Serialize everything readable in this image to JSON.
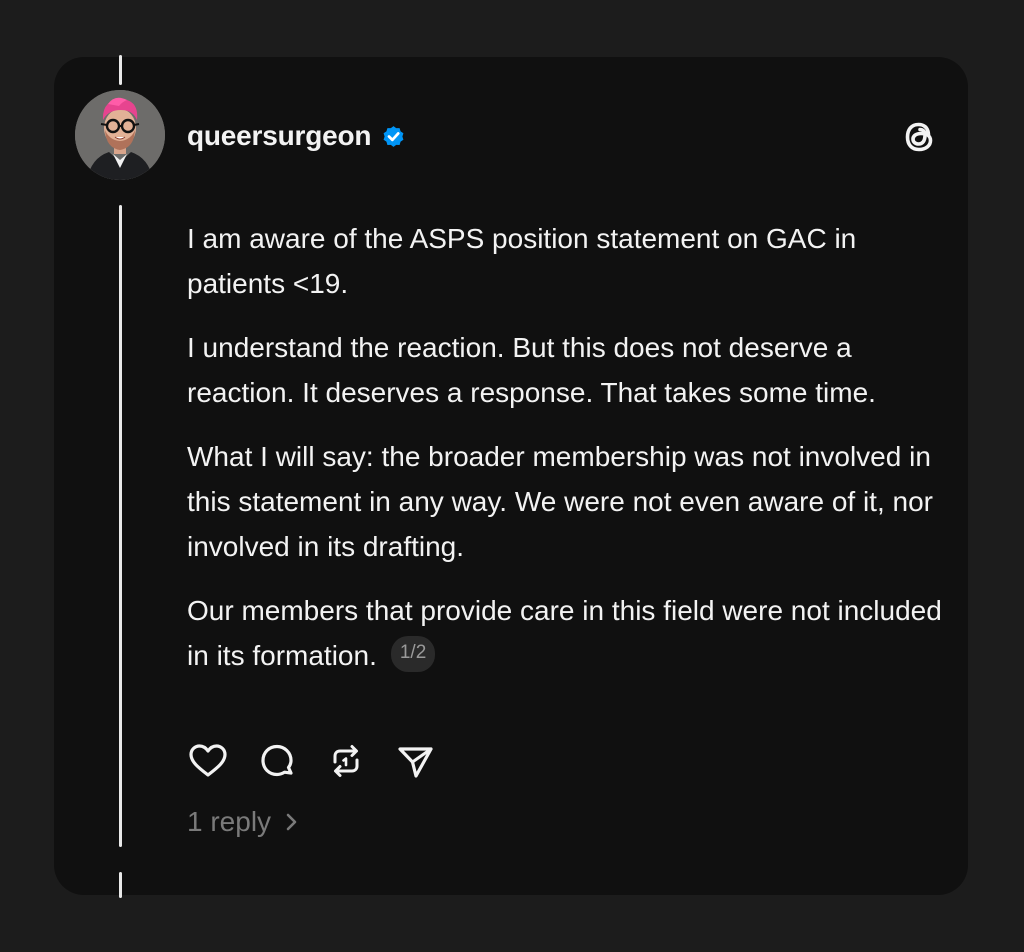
{
  "post": {
    "username": "queersurgeon",
    "verified": true,
    "paragraphs": [
      "I am aware of the ASPS position statement on GAC in patients <19.",
      "I understand the reaction. But this does not deserve a reaction. It deserves a response. That takes some time.",
      "What I will say: the broader membership was not involved in this statement in any way. We were not even aware of it, nor involved in its drafting.",
      "Our members that provide care in this field were not included in its formation."
    ],
    "page_indicator": "1/2",
    "replies_label": "1 reply"
  },
  "icons": {
    "like": "heart-icon",
    "reply": "comment-bubble-icon",
    "repost": "repost-icon",
    "share": "send-icon",
    "logo": "threads-logo-icon",
    "verified": "verified-badge-icon",
    "chevron": "chevron-right-icon"
  },
  "colors": {
    "background": "#1c1c1c",
    "card": "#101010",
    "text": "#f3f3f3",
    "muted": "#7a7a7a",
    "verified": "#0095f6",
    "thread_line": "#e9e9e9"
  }
}
